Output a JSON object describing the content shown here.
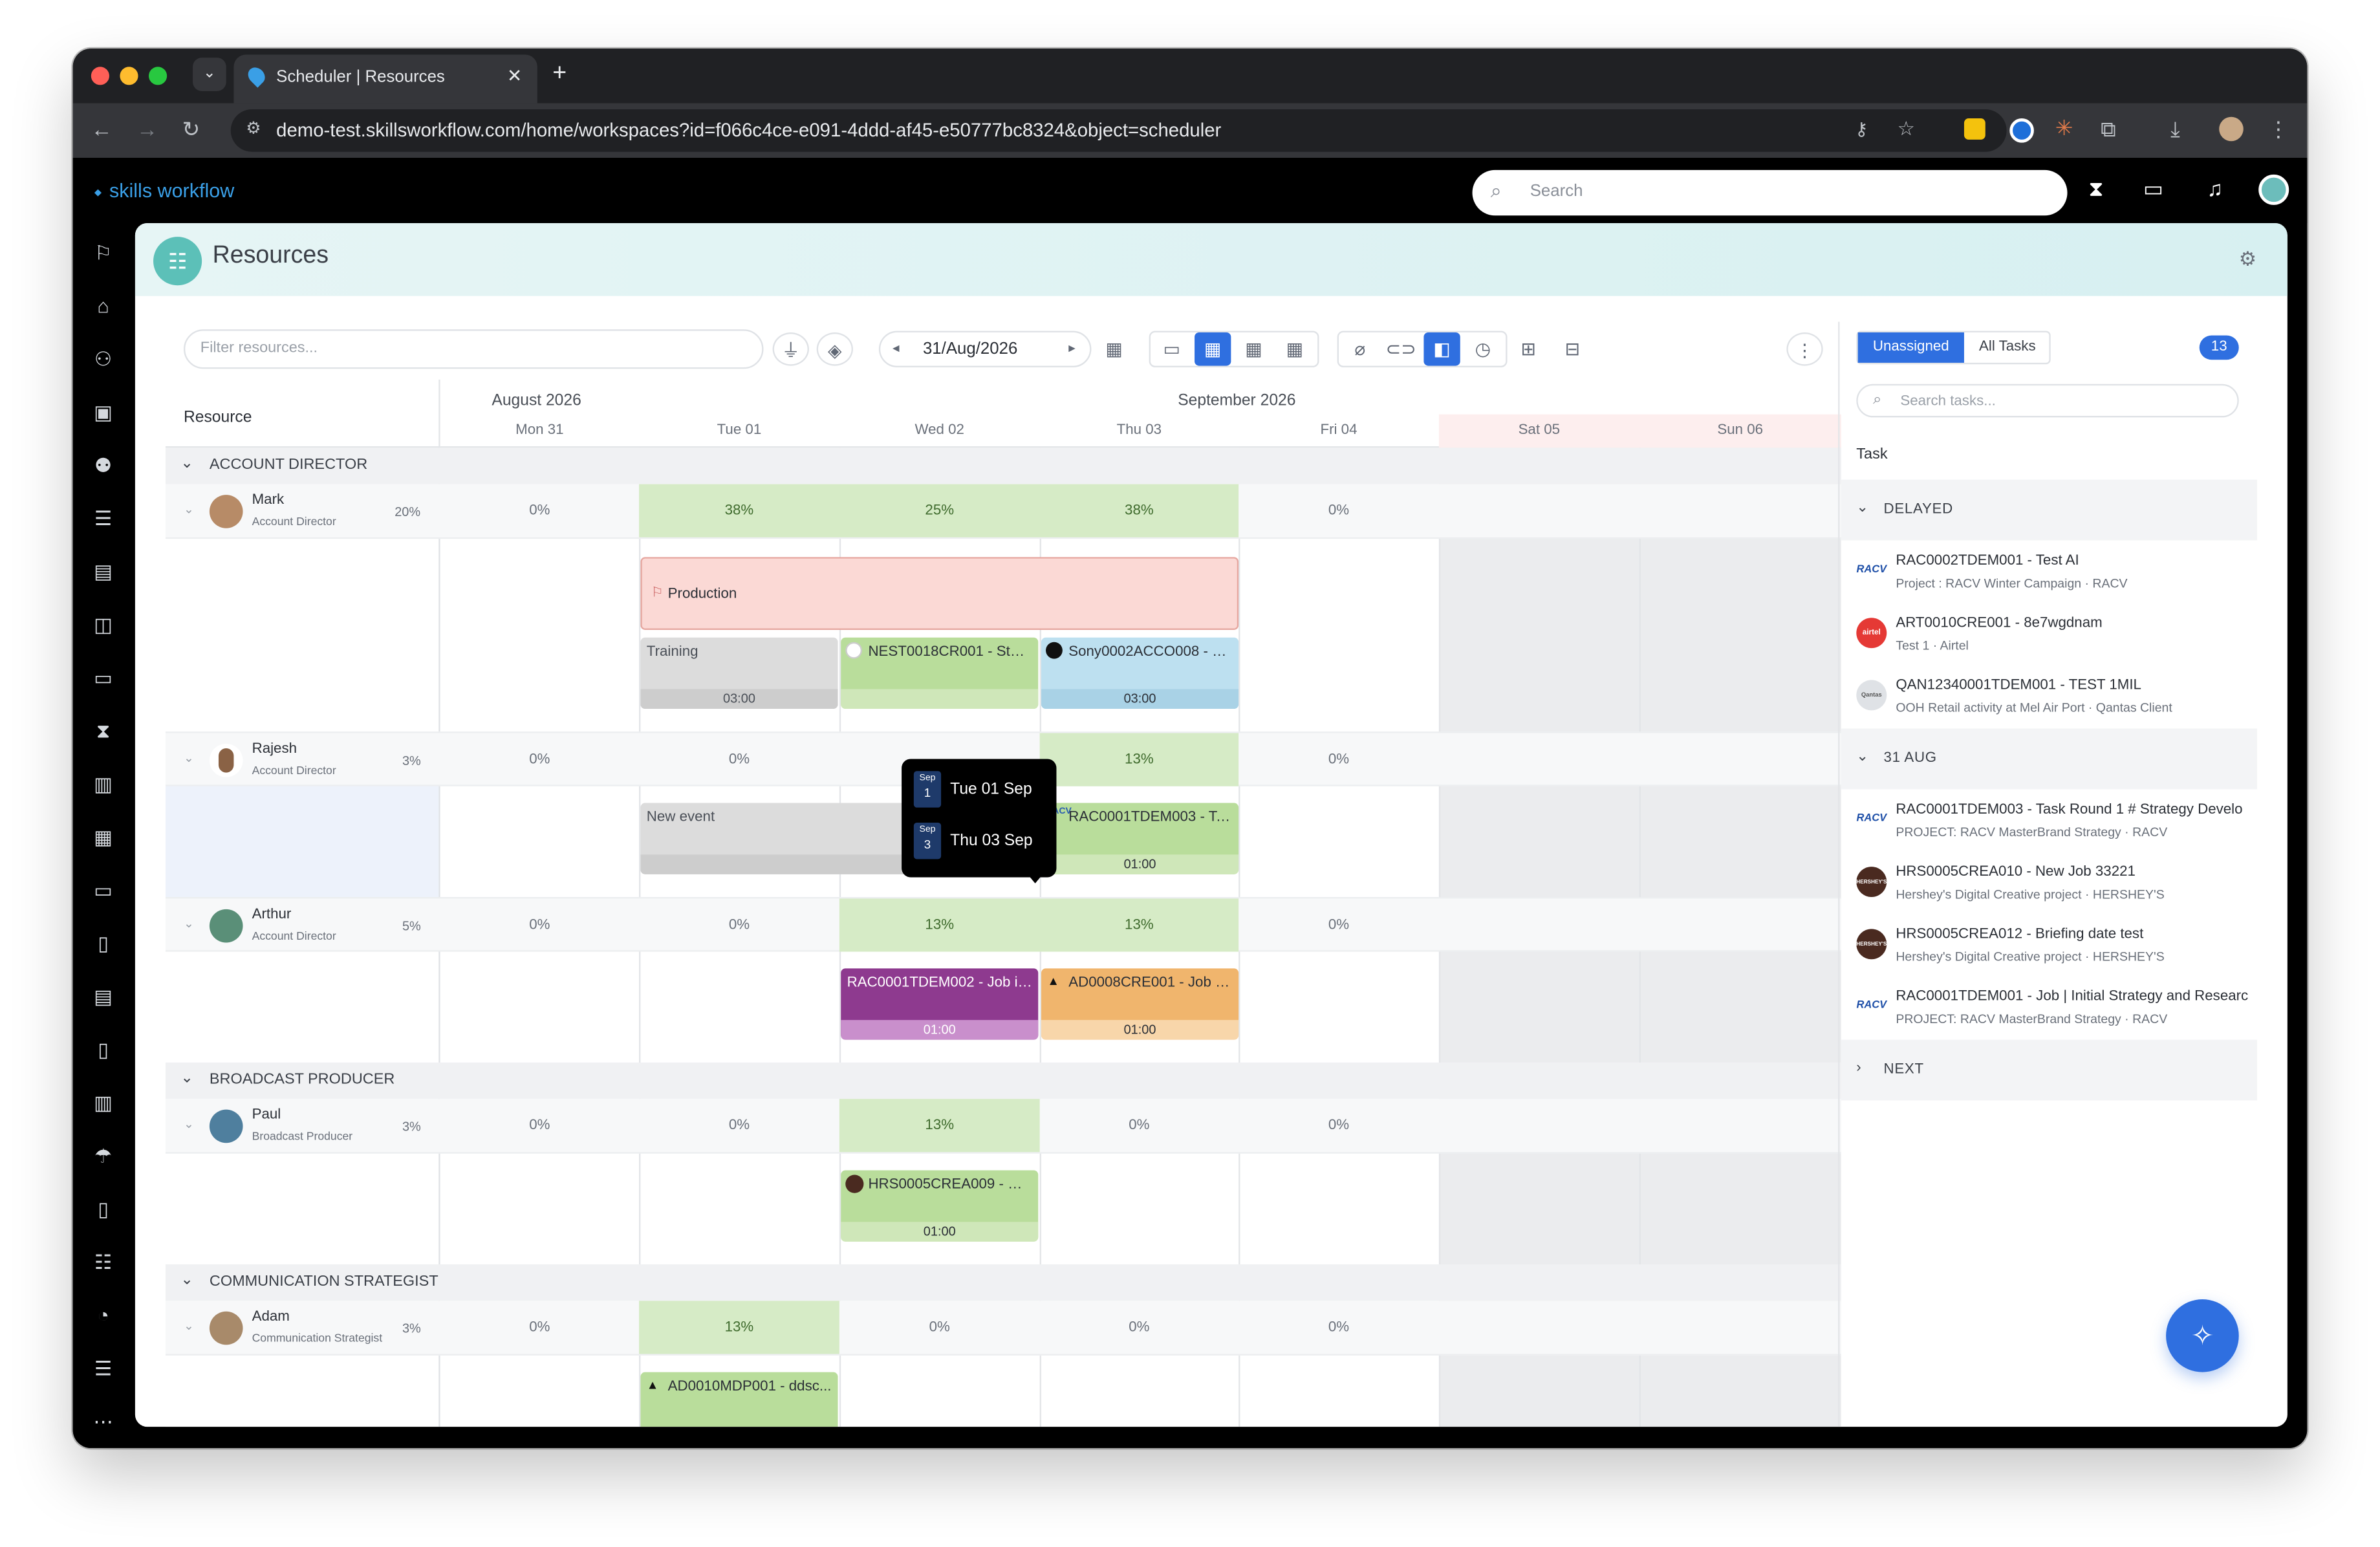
{
  "browser": {
    "tab_title": "Scheduler | Resources",
    "url": "demo-test.skillsworkflow.com/home/workspaces?id=f066c4ce-e091-4ddd-af45-e50777bc8324&object=scheduler"
  },
  "app": {
    "brand": "skills workflow",
    "search_placeholder": "Search"
  },
  "page": {
    "title": "Resources"
  },
  "toolbar": {
    "filter_placeholder": "Filter resources...",
    "date": "31/Aug/2026"
  },
  "grid": {
    "resource_header": "Resource",
    "months": [
      "August 2026",
      "September 2026"
    ],
    "days": [
      "Mon 31",
      "Tue 01",
      "Wed 02",
      "Thu 03",
      "Fri 04",
      "Sat 05",
      "Sun 06"
    ]
  },
  "groups": [
    "ACCOUNT DIRECTOR",
    "BROADCAST PRODUCER",
    "COMMUNICATION STRATEGIST"
  ],
  "resources": [
    {
      "name": "Mark",
      "role": "Account Director",
      "pct": "20%",
      "days": [
        "0%",
        "38%",
        "25%",
        "38%",
        "0%"
      ]
    },
    {
      "name": "Rajesh",
      "role": "Account Director",
      "pct": "3%",
      "days": [
        "0%",
        "0%",
        "",
        "13%",
        "0%"
      ]
    },
    {
      "name": "Arthur",
      "role": "Account Director",
      "pct": "5%",
      "days": [
        "0%",
        "0%",
        "13%",
        "13%",
        "0%"
      ]
    },
    {
      "name": "Paul",
      "role": "Broadcast Producer",
      "pct": "3%",
      "days": [
        "0%",
        "0%",
        "13%",
        "0%",
        "0%"
      ]
    },
    {
      "name": "Adam",
      "role": "Communication Strategist",
      "pct": "3%",
      "days": [
        "0%",
        "13%",
        "0%",
        "0%",
        "0%"
      ]
    }
  ],
  "events": {
    "production": "Production",
    "training": {
      "label": "Training",
      "dur": "03:00"
    },
    "nest": {
      "label": "NEST0018CR001 - Story...",
      "dur": ""
    },
    "sony": {
      "label": "Sony0002ACCO008 - 8-...",
      "dur": "03:00"
    },
    "new_event": {
      "label": "New event"
    },
    "racv3": {
      "label": "RAC0001TDEM003 - Ta...",
      "dur": "01:00"
    },
    "racv2": {
      "label": "RAC0001TDEM002 - Job in ...",
      "dur": "01:00"
    },
    "ad8": {
      "label": "AD0008CRE001 - Job d...",
      "dur": "01:00"
    },
    "hrs9": {
      "label": "HRS0005CREA009 - Ne...",
      "dur": "01:00"
    },
    "ad10": {
      "label": "AD0010MDP001 - ddsc..."
    }
  },
  "tooltip": {
    "m1": "Sep",
    "d1": "1",
    "t1": "Tue 01 Sep",
    "m2": "Sep",
    "d2": "3",
    "t2": "Thu 03 Sep"
  },
  "panel": {
    "tab_unassigned": "Unassigned",
    "tab_all": "All Tasks",
    "count": "13",
    "search_placeholder": "Search tasks...",
    "task_header": "Task",
    "g_delayed": "DELAYED",
    "g_aug": "31 AUG",
    "g_next": "NEXT",
    "delayed": [
      {
        "logo": "RACV",
        "name": "RAC0002TDEM001 - Test AI",
        "sub": "Project : RACV Winter Campaign · RACV"
      },
      {
        "logo": "airtel",
        "name": "ART0010CRE001 - 8e7wgdnam",
        "sub": "Test 1 · Airtel"
      },
      {
        "logo": "Qantas",
        "name": "QAN12340001TDEM001 - TEST 1MIL",
        "sub": "OOH Retail activity at Mel Air Port · Qantas Client"
      }
    ],
    "aug": [
      {
        "logo": "RACV",
        "name": "RAC0001TDEM003 - Task Round 1 # Strategy Develo",
        "sub": "PROJECT: RACV MasterBrand Strategy · RACV"
      },
      {
        "logo": "HERSHEY'S",
        "name": "HRS0005CREA010 - New Job 33221",
        "sub": "Hershey's Digital Creative project · HERSHEY'S"
      },
      {
        "logo": "HERSHEY'S",
        "name": "HRS0005CREA012 - Briefing date test",
        "sub": "Hershey's Digital Creative project · HERSHEY'S"
      },
      {
        "logo": "RACV",
        "name": "RAC0001TDEM001 - Job | Initial Strategy and Researc",
        "sub": "PROJECT: RACV MasterBrand Strategy · RACV"
      }
    ]
  },
  "colors": {
    "accent": "#2f6fe0",
    "brand": "#3a9fe6",
    "green": "#d6ebc6",
    "pink": "#fbd9d5",
    "purple": "#8e3a8f",
    "orange": "#f0b56d",
    "blue": "#bde0f0"
  }
}
